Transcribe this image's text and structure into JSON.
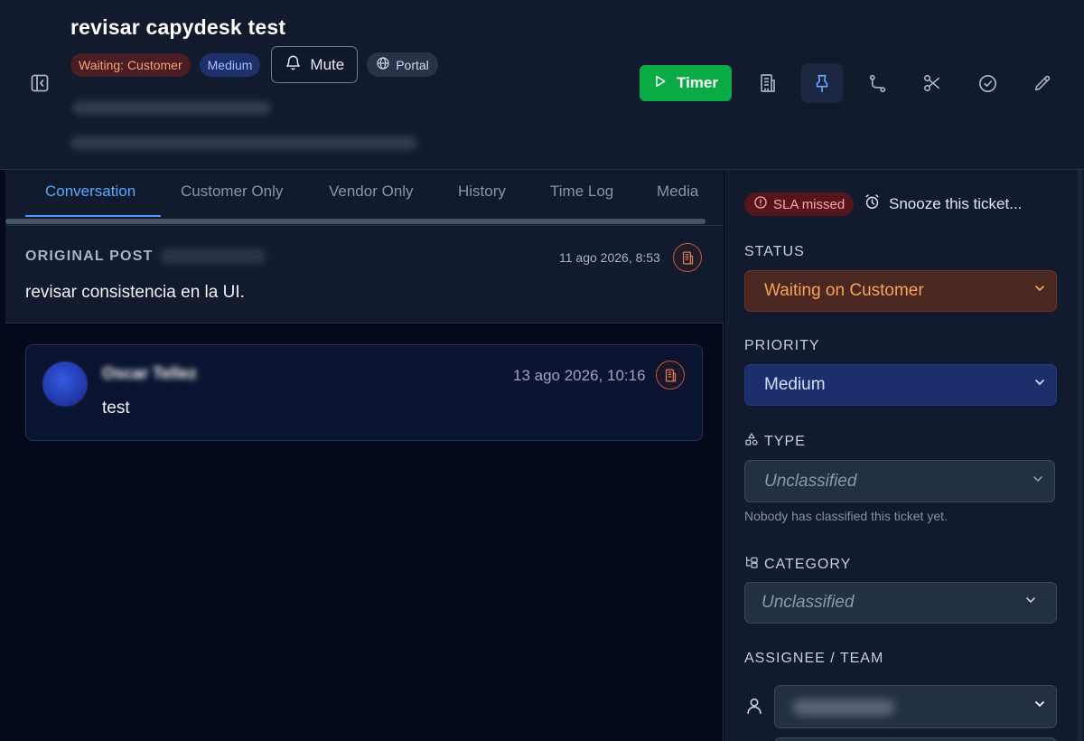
{
  "header": {
    "title": "revisar capydesk test",
    "status_badge": "Waiting: Customer",
    "priority_badge": "Medium",
    "mute_label": "Mute",
    "portal_label": "Portal",
    "timer_label": "Timer"
  },
  "tabs": [
    {
      "label": "Conversation"
    },
    {
      "label": "Customer Only"
    },
    {
      "label": "Vendor Only"
    },
    {
      "label": "History"
    },
    {
      "label": "Time Log"
    },
    {
      "label": "Media"
    }
  ],
  "original_post": {
    "label": "ORIGINAL POST",
    "date": "11 ago 2026, 8:53",
    "text": "revisar consistencia en la UI."
  },
  "message": {
    "author": "Oscar Tellez",
    "date": "13 ago 2026, 10:16",
    "text": "test"
  },
  "sidebar": {
    "sla_label": "SLA missed",
    "snooze_label": "Snooze this ticket...",
    "status_label": "STATUS",
    "status_value": "Waiting on Customer",
    "priority_label": "PRIORITY",
    "priority_value": "Medium",
    "type_label": "TYPE",
    "type_value": "Unclassified",
    "type_helper": "Nobody has classified this ticket yet.",
    "category_label": "CATEGORY",
    "category_value": "Unclassified",
    "assignee_label": "ASSIGNEE / TEAM"
  },
  "colors": {
    "timer": "#0aaa45",
    "accent": "#4d9aff",
    "status_text": "#f6a35a",
    "sla": "#ffa5a5"
  },
  "icons": [
    "sidebar-toggle-icon",
    "bell-icon",
    "globe-icon",
    "play-icon",
    "building-icon",
    "pin-icon",
    "route-icon",
    "scissors-icon",
    "check-circle-icon",
    "pencil-icon",
    "alert-circle-icon",
    "alarm-clock-icon",
    "chevron-down-icon",
    "shapes-icon",
    "folder-tree-icon",
    "user-icon"
  ]
}
